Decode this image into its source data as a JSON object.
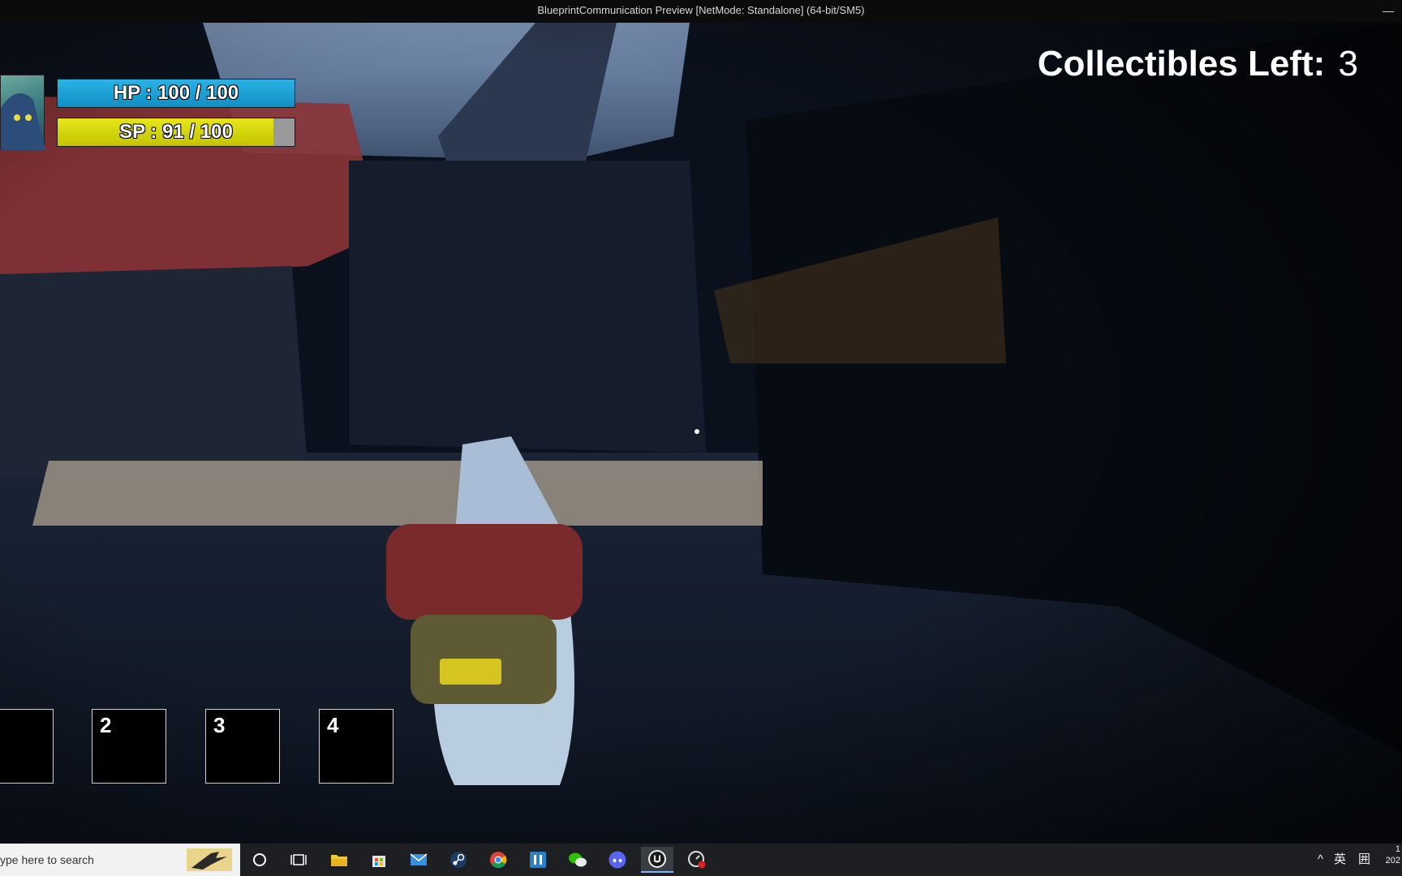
{
  "window": {
    "title": "BlueprintCommunication Preview [NetMode: Standalone]  (64-bit/SM5)",
    "minimize_glyph": "—"
  },
  "hud": {
    "hp": {
      "text": "HP : 100 / 100",
      "current": 100,
      "max": 100,
      "color": "#1aa0d6"
    },
    "sp": {
      "text": "SP : 91 / 100",
      "current": 91,
      "max": 100,
      "color": "#d8d80a"
    },
    "collectibles": {
      "label": "Collectibles Left:",
      "value": "3"
    },
    "hotbar": [
      {
        "label": ""
      },
      {
        "label": "2"
      },
      {
        "label": "3"
      },
      {
        "label": "4"
      }
    ]
  },
  "taskbar": {
    "search_placeholder": "ype here to search",
    "apps": [
      "cortana-icon",
      "task-view-icon",
      "file-explorer-icon",
      "microsoft-store-icon",
      "mail-icon",
      "steam-icon",
      "chrome-icon",
      "app-icon",
      "wechat-icon",
      "discord-icon",
      "unreal-engine-icon",
      "recorder-icon"
    ],
    "tray": {
      "chevron": "^",
      "ime": "英",
      "input_mode": "囲"
    },
    "clock": {
      "time": "1",
      "date": "202"
    }
  }
}
